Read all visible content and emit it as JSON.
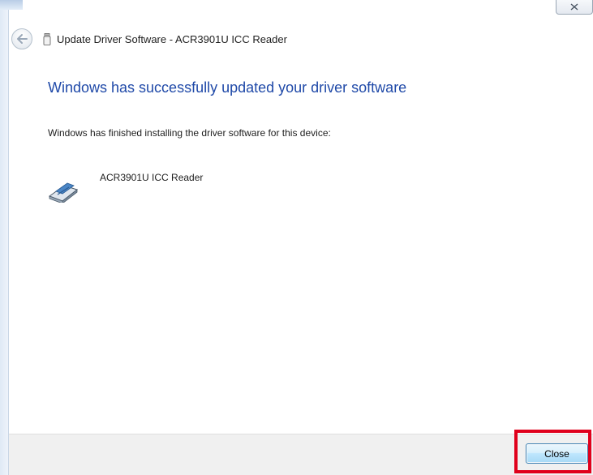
{
  "window": {
    "title": "Update Driver Software - ACR3901U ICC Reader",
    "caption_close_icon": "close-icon"
  },
  "header": {
    "back_icon": "back-arrow-icon",
    "device_icon": "usb-device-icon"
  },
  "main": {
    "heading": "Windows has successfully updated your driver software",
    "finished_text": "Windows has finished installing the driver software for this device:",
    "device": {
      "icon": "card-reader-icon",
      "name": "ACR3901U ICC Reader"
    }
  },
  "footer": {
    "close_label": "Close"
  },
  "colors": {
    "heading": "#1f49a8",
    "highlight": "#e0001b",
    "footer_bg": "#f0f0f0",
    "button_border": "#3c7fb1"
  }
}
